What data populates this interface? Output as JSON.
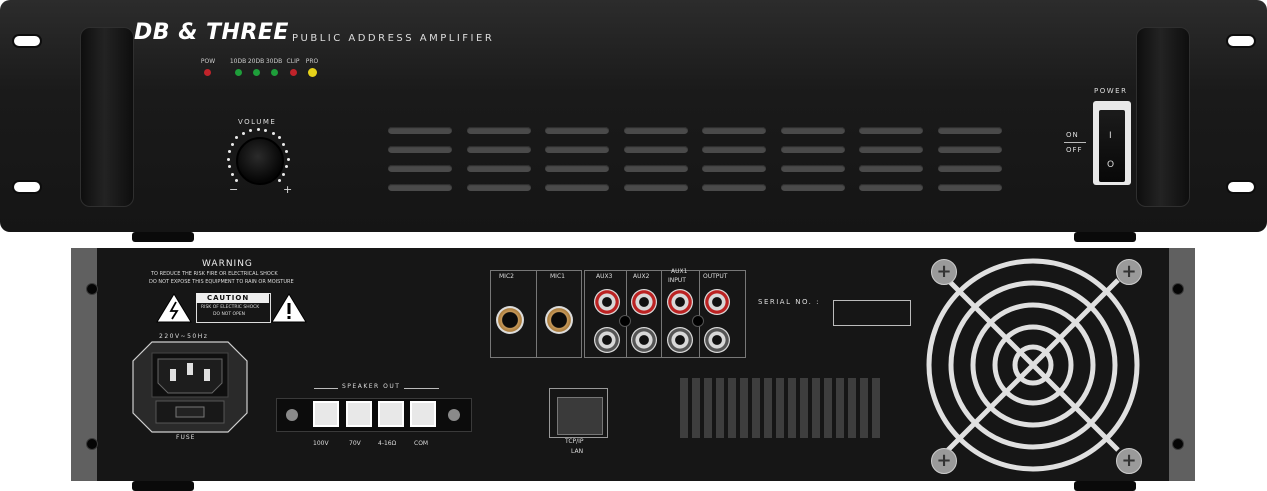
{
  "front": {
    "brand": "DB & THREE",
    "subtitle": "PUBLIC ADDRESS AMPLIFIER",
    "indicators": [
      {
        "label": "POW",
        "color": "#c0232a"
      },
      {
        "label": "10DB",
        "color": "#1e9e3a"
      },
      {
        "label": "20DB",
        "color": "#1e9e3a"
      },
      {
        "label": "30DB",
        "color": "#1e9e3a"
      },
      {
        "label": "CLIP",
        "color": "#c0232a"
      },
      {
        "label": "PRO",
        "color": "#e6d21a"
      }
    ],
    "volume_label": "VOLUME",
    "volume_minus": "−",
    "volume_plus": "+",
    "power_label": "POWER",
    "power_on_mark": "I",
    "power_off_mark": "O",
    "on_label": "ON",
    "off_label": "OFF"
  },
  "rear": {
    "warning_title": "WARNING",
    "warning_line1": "TO REDUCE THE RISK FIRE OR ELECTRICAL SHOCK",
    "warning_line2": "DO NOT EXPOSE THIS EQUIPMENT TO RAIN OR MOISTURE",
    "caution_title": "CAUTION",
    "caution_line1": "RISK OF ELECTRIC SHOCK",
    "caution_line2": "DO NOT OPEN",
    "power_spec": "220V~50Hz",
    "fuse_label": "FUSE",
    "speaker_out_label": "SPEAKER OUT",
    "speaker_terms": [
      "100V",
      "70V",
      "4-16Ω",
      "COM"
    ],
    "mic_labels": [
      "MIC2",
      "MIC1"
    ],
    "aux_labels": [
      "AUX3",
      "AUX2",
      "AUX1",
      "OUTPUT"
    ],
    "input_label": "INPUT",
    "lan_label_1": "TCP/IP",
    "lan_label_2": "LAN",
    "serial_label": "SERIAL NO. :",
    "fan_screw_glyph": "+"
  },
  "colors": {
    "panel": "#1a1a1a",
    "rail": "#606060",
    "jack_red": "#b22222",
    "mic_gold": "#c89a5a"
  }
}
